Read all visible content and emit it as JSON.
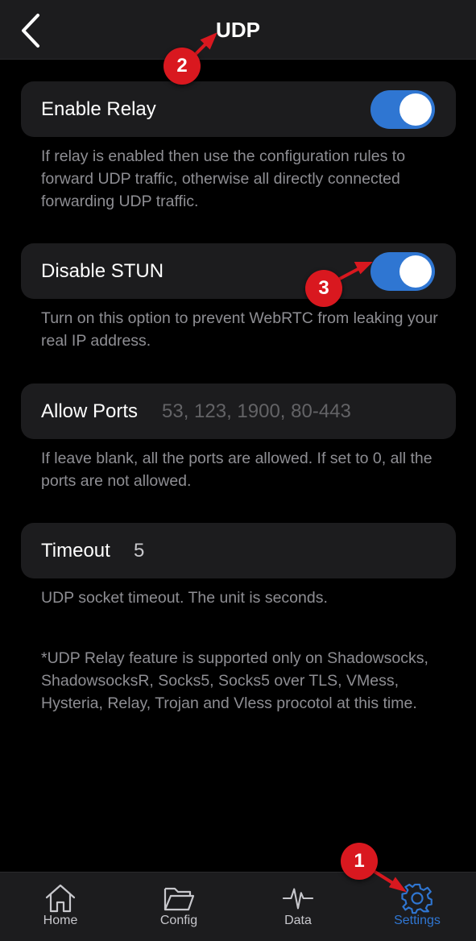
{
  "nav": {
    "title": "UDP"
  },
  "enable_relay": {
    "label": "Enable Relay",
    "on": true,
    "description": "If relay is enabled then use the configuration rules to forward UDP traffic, otherwise all directly connected forwarding UDP traffic."
  },
  "disable_stun": {
    "label": "Disable STUN",
    "on": true,
    "description": "Turn on this option to prevent WebRTC from leaking your real IP address."
  },
  "allow_ports": {
    "label": "Allow Ports",
    "value": "",
    "placeholder": "53, 123, 1900, 80-443",
    "description": "If leave blank, all the ports are allowed. If set to 0, all the ports are not allowed."
  },
  "timeout": {
    "label": "Timeout",
    "value": "5",
    "description": "UDP socket timeout. The unit is seconds."
  },
  "footnote": "*UDP Relay feature is supported only on Shadowsocks, ShadowsocksR, Socks5, Socks5 over TLS, VMess, Hysteria, Relay, Trojan and Vless procotol at this time.",
  "tabs": [
    {
      "label": "Home",
      "icon": "home-icon"
    },
    {
      "label": "Config",
      "icon": "folder-icon"
    },
    {
      "label": "Data",
      "icon": "pulse-icon"
    },
    {
      "label": "Settings",
      "icon": "gear-icon",
      "active": true
    }
  ],
  "badges": {
    "b1": "1",
    "b2": "2",
    "b3": "3"
  },
  "colors": {
    "accent": "#2f76d2",
    "badge": "#d9181f",
    "cell": "#1c1c1e",
    "background": "#000000"
  }
}
